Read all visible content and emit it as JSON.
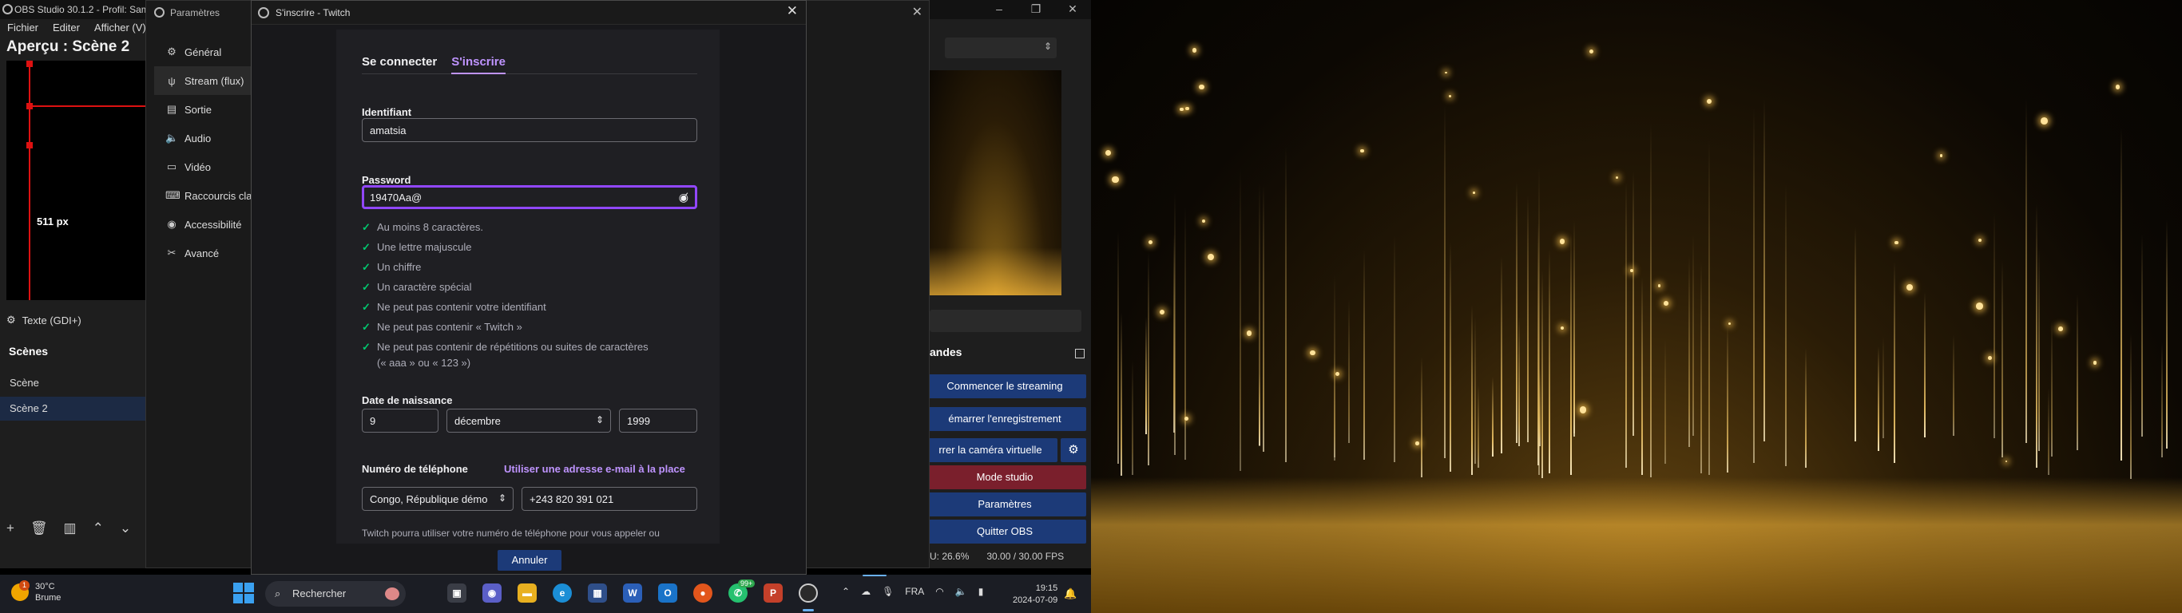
{
  "obs": {
    "title": "OBS Studio 30.1.2 - Profil: Sam",
    "menu": [
      "Fichier",
      "Editer",
      "Afficher (V)"
    ],
    "preview_label": "Aperçu : Scène 2",
    "preview_px": "511 px",
    "source_label": "Texte (GDI+)",
    "scenes_title": "Scènes",
    "scenes": [
      "Scène",
      "Scène 2"
    ],
    "controls_title": "andes",
    "controls": [
      "Commencer le streaming",
      "émarrer l'enregistrement",
      "rrer la caméra virtuelle",
      "Mode studio",
      "Paramètres",
      "Quitter OBS"
    ],
    "status_cpu": "PU: 26.6%",
    "status_fps": "30.00 / 30.00 FPS"
  },
  "settings": {
    "title": "Paramètres",
    "nav": [
      {
        "label": "Général",
        "icon": "gear-icon",
        "glyph": "⚙"
      },
      {
        "label": "Stream (flux)",
        "icon": "antenna-icon",
        "glyph": "ψ"
      },
      {
        "label": "Sortie",
        "icon": "output-icon",
        "glyph": "▤"
      },
      {
        "label": "Audio",
        "icon": "speaker-icon",
        "glyph": "🔈"
      },
      {
        "label": "Vidéo",
        "icon": "monitor-icon",
        "glyph": "▭"
      },
      {
        "label": "Raccourcis cla",
        "icon": "keyboard-icon",
        "glyph": "⌨"
      },
      {
        "label": "Accessibilité",
        "icon": "accessibility-icon",
        "glyph": "◉"
      },
      {
        "label": "Avancé",
        "icon": "tools-icon",
        "glyph": "✂"
      }
    ]
  },
  "twitch": {
    "title": "S'inscrire - Twitch",
    "tabs": [
      "Se connecter",
      "S'inscrire"
    ],
    "username_label": "Identifiant",
    "username_value": "amatsia",
    "password_label": "Password",
    "password_value": "19470Aa@",
    "rules": [
      "Au moins 8 caractères.",
      "Une lettre majuscule",
      "Un chiffre",
      "Un caractère spécial",
      "Ne peut pas contenir votre identifiant",
      "Ne peut pas contenir « Twitch »",
      "Ne peut pas contenir de répétitions ou suites de caractères",
      "(« aaa » ou « 123 »)"
    ],
    "dob_label": "Date de naissance",
    "dob_day": "9",
    "dob_month": "décembre",
    "dob_year": "1999",
    "phone_label": "Numéro de téléphone",
    "alt_email_link": "Utiliser une adresse e-mail à la place",
    "country": "Congo, République démo",
    "phone_value": "+243 820 391 021",
    "phone_note": "Twitch pourra utiliser votre numéro de téléphone pour vous appeler ou",
    "cancel_label": "Annuler"
  },
  "taskbar": {
    "weather_temp": "30°C",
    "weather_desc": "Brume",
    "weather_badge": "1",
    "search_placeholder": "Rechercher",
    "whatsapp_badge": "99+",
    "language": "FRA",
    "time": "19:15",
    "date": "2024-07-09"
  }
}
